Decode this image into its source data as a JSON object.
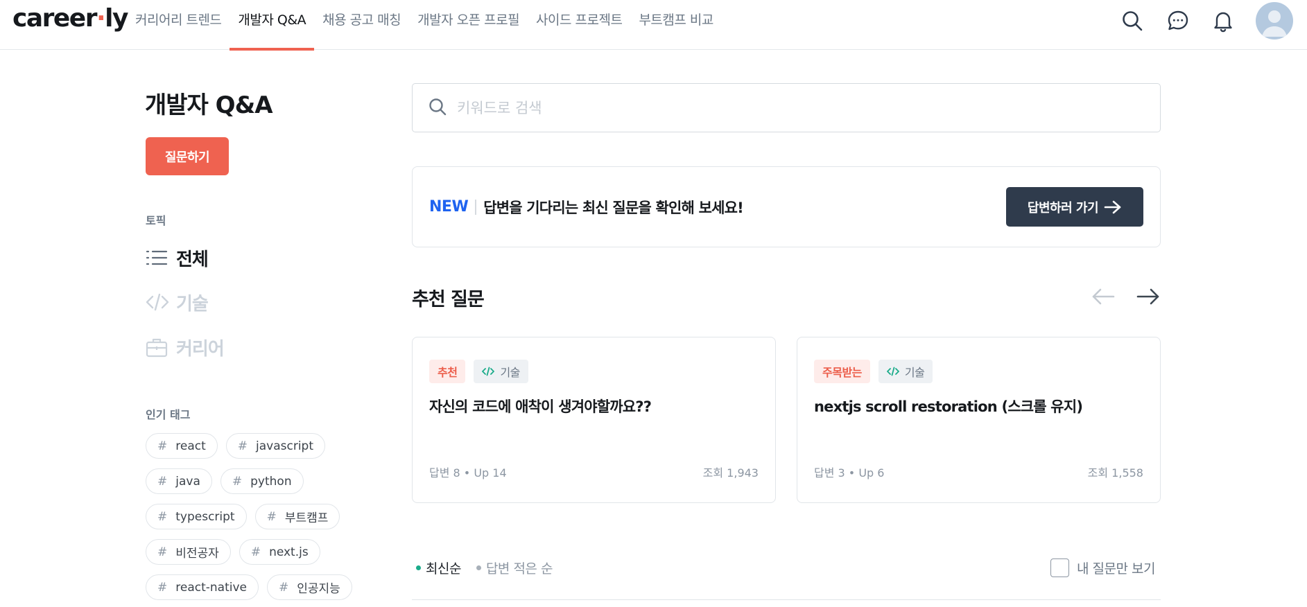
{
  "header": {
    "logo_main": "careerly",
    "nav": [
      {
        "label": "커리어리 트렌드",
        "active": false
      },
      {
        "label": "개발자 Q&A",
        "active": true
      },
      {
        "label": "채용 공고 매칭",
        "active": false
      },
      {
        "label": "개발자 오픈 프로필",
        "active": false
      },
      {
        "label": "사이드 프로젝트",
        "active": false
      },
      {
        "label": "부트캠프 비교",
        "active": false
      }
    ],
    "icons": [
      "search-icon",
      "chat-icon",
      "bell-icon",
      "avatar"
    ]
  },
  "sidebar": {
    "title": "개발자 Q&A",
    "ask_button": "질문하기",
    "topics_label": "토픽",
    "topics": [
      {
        "label": "전체",
        "icon": "list-icon",
        "active": true
      },
      {
        "label": "기술",
        "icon": "code-icon",
        "active": false
      },
      {
        "label": "커리어",
        "icon": "briefcase-icon",
        "active": false
      }
    ],
    "tags_label": "인기 태그",
    "tags": [
      "react",
      "javascript",
      "java",
      "python",
      "typescript",
      "부트캠프",
      "비전공자",
      "next.js",
      "react-native",
      "인공지능"
    ]
  },
  "main": {
    "search": {
      "placeholder": "키워드로 검색",
      "value": ""
    },
    "banner": {
      "new_label": "NEW",
      "message": "답변을 기다리는 최신 질문을 확인해 보세요!",
      "button_label": "답변하러 가기"
    },
    "recommended": {
      "title": "추천 질문",
      "cards": [
        {
          "badge": "추천",
          "topic": "기술",
          "title": "자신의 코드에 애착이 생겨야할까요??",
          "meta": "답변 8 • Up 14",
          "views": "조회 1,943"
        },
        {
          "badge": "주목받는",
          "topic": "기술",
          "title": "nextjs scroll restoration (스크롤 유지)",
          "meta": "답변 3 • Up 6",
          "views": "조회 1,558"
        }
      ]
    },
    "sort": {
      "options": [
        {
          "label": "최신순",
          "active": true
        },
        {
          "label": "답변 적은 순",
          "active": false
        }
      ],
      "my_questions_label": "내 질문만 보기",
      "my_questions_checked": false
    }
  },
  "colors": {
    "brand": "#ef6250",
    "new_blue": "#1f63f0",
    "dark_button": "#2f3b4c",
    "sort_active_dot": "#1aab8a"
  }
}
